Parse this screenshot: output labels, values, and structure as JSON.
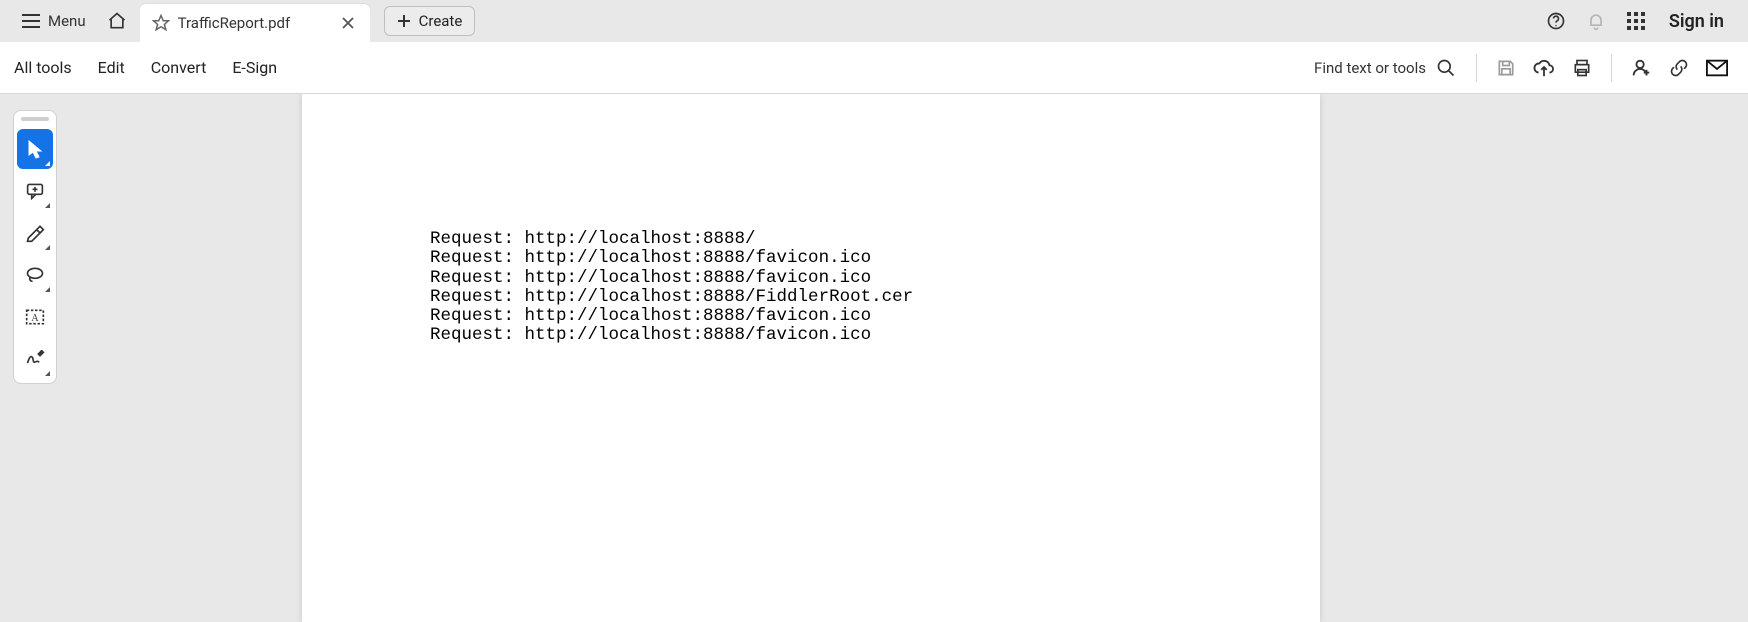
{
  "titlebar": {
    "menu_label": "Menu",
    "tab_title": "TrafficReport.pdf",
    "create_label": "Create",
    "signin_label": "Sign in"
  },
  "toolbar": {
    "items": [
      "All tools",
      "Edit",
      "Convert",
      "E-Sign"
    ],
    "find_label": "Find text or tools"
  },
  "document": {
    "lines": [
      "Request: http://localhost:8888/",
      "Request: http://localhost:8888/favicon.ico",
      "Request: http://localhost:8888/favicon.ico",
      "Request: http://localhost:8888/FiddlerRoot.cer",
      "Request: http://localhost:8888/favicon.ico",
      "Request: http://localhost:8888/favicon.ico"
    ]
  }
}
